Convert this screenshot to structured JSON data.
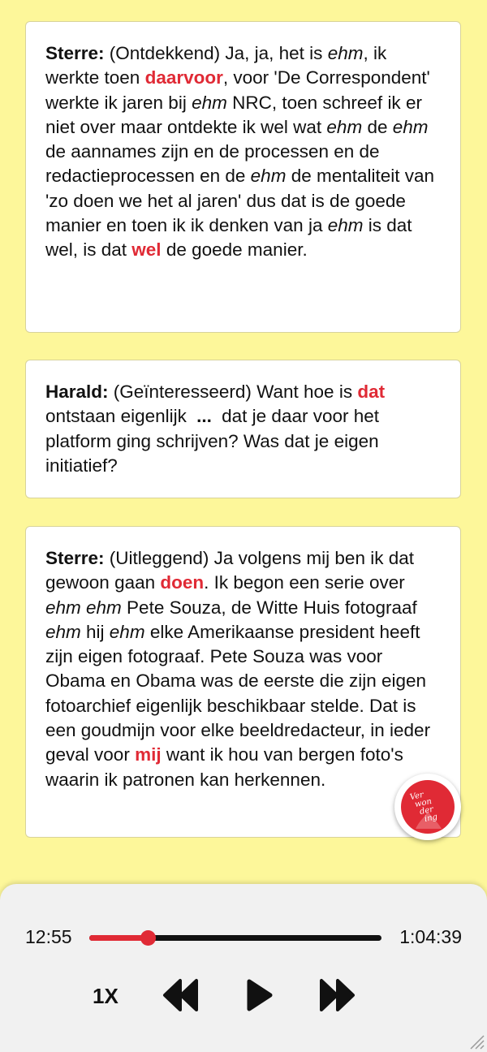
{
  "cards": [
    {
      "speaker": "Sterre:",
      "segments": [
        {
          "t": " (Ontdekkend) Ja, ja, het is "
        },
        {
          "t": "ehm",
          "s": "em"
        },
        {
          "t": ", ik werkte toen "
        },
        {
          "t": "daarvoor",
          "s": "hl"
        },
        {
          "t": ", voor 'De Correspondent' werkte ik jaren bij "
        },
        {
          "t": "ehm",
          "s": "em"
        },
        {
          "t": " NRC, toen schreef ik er niet over maar ontdekte ik wel wat "
        },
        {
          "t": "ehm",
          "s": "em"
        },
        {
          "t": " de "
        },
        {
          "t": "ehm",
          "s": "em"
        },
        {
          "t": " de aannames zijn en de processen en de redactieprocessen en de "
        },
        {
          "t": "ehm",
          "s": "em"
        },
        {
          "t": " de mentaliteit van 'zo doen we het al jaren' dus dat is de goede manier en toen ik ik denken van ja "
        },
        {
          "t": "ehm",
          "s": "em"
        },
        {
          "t": " is dat wel, is dat "
        },
        {
          "t": "wel",
          "s": "hl"
        },
        {
          "t": " de goede manier."
        }
      ]
    },
    {
      "speaker": "Harald:",
      "segments": [
        {
          "t": " (Geïnteresseerd) Want hoe is "
        },
        {
          "t": "dat",
          "s": "hl"
        },
        {
          "t": " ontstaan eigenlijk "
        },
        {
          "t": "...",
          "s": "ellipsis"
        },
        {
          "t": " dat je daar voor het platform ging schrijven? Was dat je eigen initiatief?"
        }
      ]
    },
    {
      "speaker": "Sterre:",
      "segments": [
        {
          "t": " (Uitleggend) Ja volgens mij ben ik dat gewoon gaan "
        },
        {
          "t": "doen",
          "s": "hl"
        },
        {
          "t": ". Ik begon een serie over "
        },
        {
          "t": "ehm ehm",
          "s": "em"
        },
        {
          "t": " Pete Souza, de Witte Huis fotograaf "
        },
        {
          "t": "ehm",
          "s": "em"
        },
        {
          "t": " hij "
        },
        {
          "t": "ehm",
          "s": "em"
        },
        {
          "t": " elke Amerikaanse president heeft zijn eigen fotograaf. Pete Souza was voor Obama en Obama was de eerste die zijn eigen fotoarchief eigenlijk beschikbaar stelde. Dat is een goudmijn voor elke beeldredacteur, in ieder geval voor "
        },
        {
          "t": "mij",
          "s": "hl"
        },
        {
          "t": " want ik hou van bergen foto's waarin ik patronen kan herkennen."
        }
      ]
    }
  ],
  "badge": {
    "line1": "Ver",
    "line2": "won",
    "line3": "der",
    "line4": "ing",
    "icon": "verwondering-logo-icon"
  },
  "player": {
    "current_time": "12:55",
    "total_time": "1:04:39",
    "progress": 0.1997,
    "speed_label": "1X",
    "rewind_icon": "rewind-icon",
    "play_icon": "play-icon",
    "forward_icon": "fast-forward-icon"
  },
  "colors": {
    "background": "#fdf79a",
    "accent": "#e02a35",
    "card": "#ffffff",
    "player": "#f1f1f1"
  }
}
